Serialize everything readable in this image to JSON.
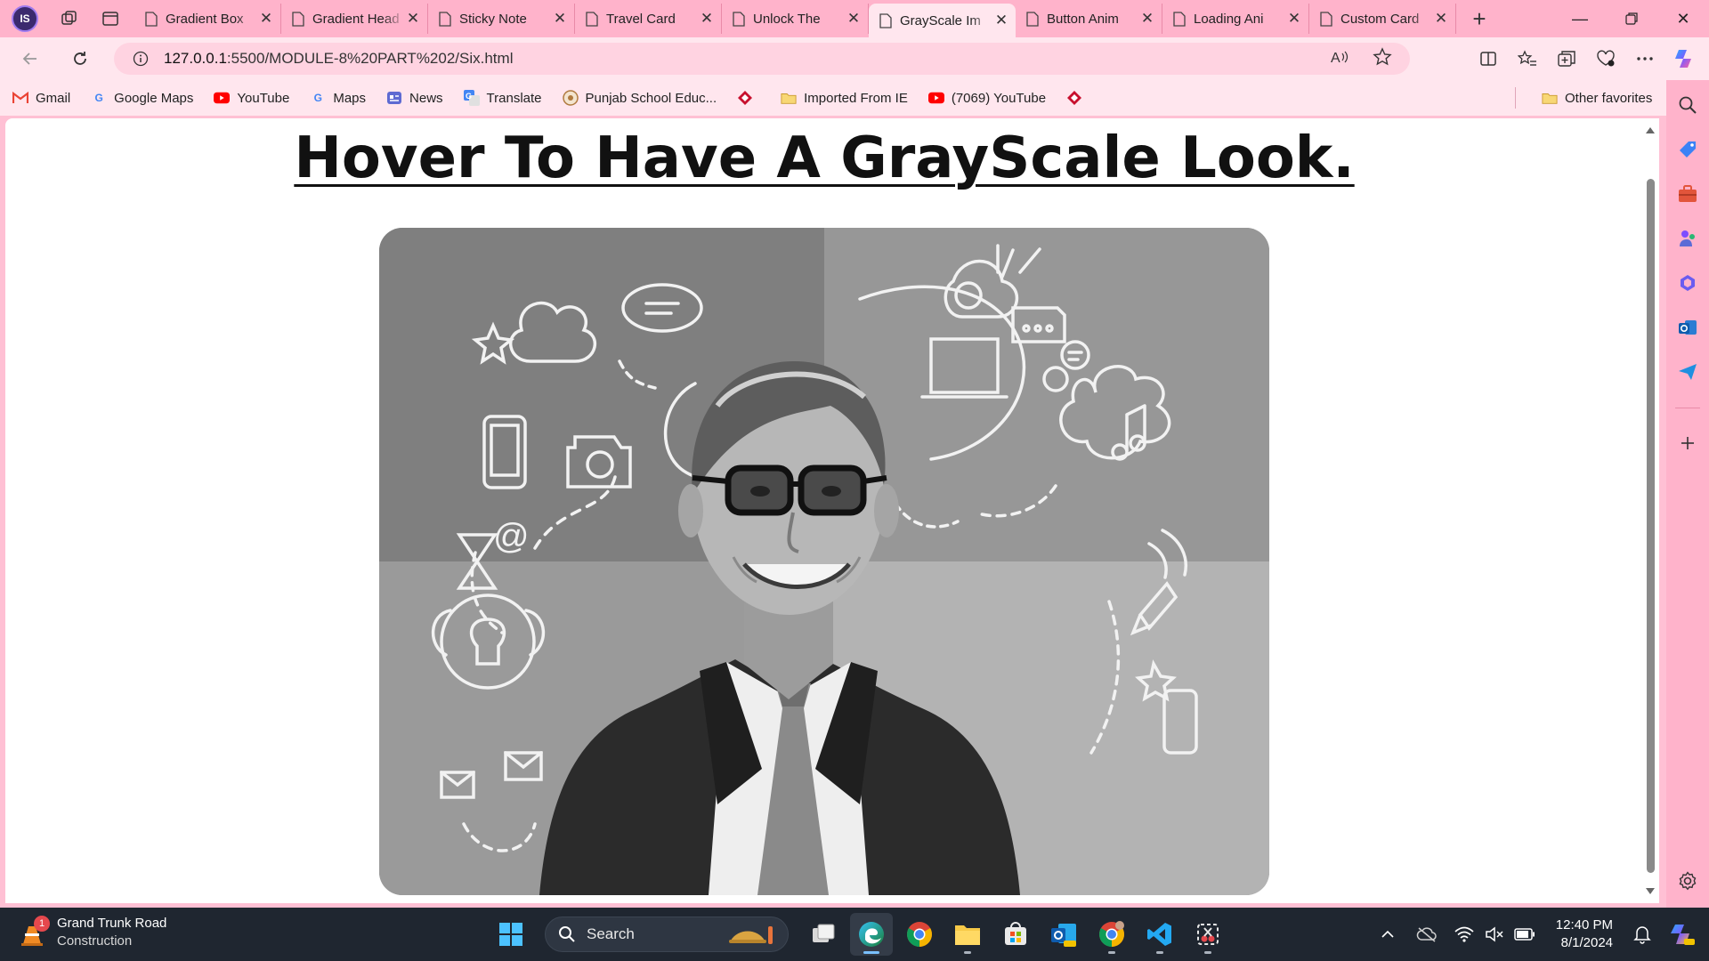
{
  "browser": {
    "profile_initials": "IS",
    "tabs": [
      {
        "label": "Gradient Box",
        "active": false
      },
      {
        "label": "Gradient Head",
        "active": false
      },
      {
        "label": "Sticky Note",
        "active": false
      },
      {
        "label": "Travel Card",
        "active": false
      },
      {
        "label": "Unlock The",
        "active": false
      },
      {
        "label": "GrayScale Im",
        "active": true
      },
      {
        "label": "Button Anim",
        "active": false
      },
      {
        "label": "Loading Ani",
        "active": false
      },
      {
        "label": "Custom Card",
        "active": false
      }
    ],
    "url_host": "127.0.0.1",
    "url_path": ":5500/MODULE-8%20PART%202/Six.html"
  },
  "favorites": {
    "items": [
      {
        "label": "Gmail",
        "icon": "gmail-icon",
        "color": "#EA4335"
      },
      {
        "label": "Google Maps",
        "icon": "google-icon",
        "color": "#4285F4"
      },
      {
        "label": "YouTube",
        "icon": "youtube-icon",
        "color": "#FF0000"
      },
      {
        "label": "Maps",
        "icon": "google-icon",
        "color": "#4285F4"
      },
      {
        "label": "News",
        "icon": "news-icon",
        "color": "#5E6AD2"
      },
      {
        "label": "Translate",
        "icon": "translate-icon",
        "color": "#4285F4"
      },
      {
        "label": "Punjab School Educ...",
        "icon": "school-icon",
        "color": "#B07A3F"
      },
      {
        "label": "",
        "icon": "diamond-icon",
        "color": "#C8102E"
      },
      {
        "label": "Imported From IE",
        "icon": "folder-icon",
        "color": "#F2C14E"
      },
      {
        "label": "(7069) YouTube",
        "icon": "youtube-icon",
        "color": "#FF0000"
      },
      {
        "label": "",
        "icon": "diamond-icon",
        "color": "#C8102E"
      }
    ],
    "other_label": "Other favorites"
  },
  "page": {
    "heading": "Hover To Have A GrayScale Look."
  },
  "taskbar": {
    "weather_title": "Grand Trunk Road",
    "weather_sub": "Construction",
    "weather_badge": "1",
    "search_placeholder": "Search",
    "time": "12:40 PM",
    "date": "8/1/2024"
  },
  "colors": {
    "tabstrip": "#ffb3cb",
    "toolbar": "#ffe6ee",
    "taskbar": "#1f2630"
  }
}
